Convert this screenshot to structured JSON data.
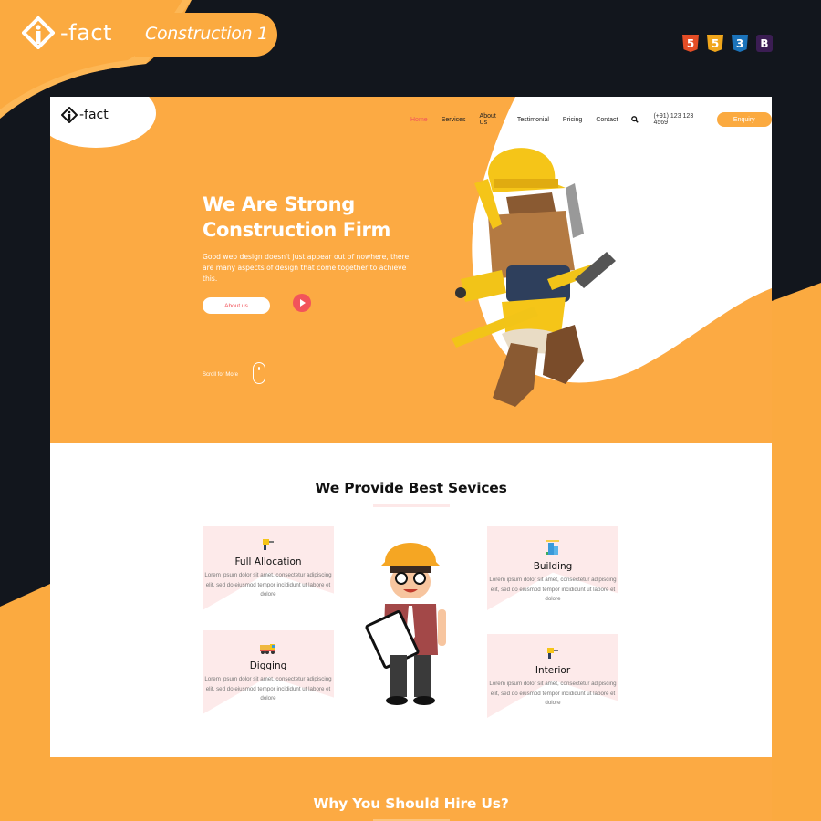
{
  "promo": {
    "brand": "-fact",
    "title": "Construction 1",
    "tech_badges": [
      {
        "name": "html5-icon",
        "glyph": "5",
        "color": "#e44d26"
      },
      {
        "name": "js-icon",
        "glyph": "5",
        "color": "#f0a61b"
      },
      {
        "name": "css3-icon",
        "glyph": "3",
        "color": "#1b73ba"
      },
      {
        "name": "bootstrap-icon",
        "glyph": "B",
        "color": "#3b1d53"
      }
    ]
  },
  "site": {
    "logo_text": "-fact",
    "nav": {
      "items": [
        "Home",
        "Services",
        "About Us",
        "Testimonial",
        "Pricing",
        "Contact"
      ],
      "active": "Home",
      "phone": "(+91) 123 123 4569",
      "enquiry_label": "Enquiry"
    },
    "hero": {
      "title_line1": "We Are Strong",
      "title_line2": "Construction Firm",
      "description": "Good web design doesn't just appear out of nowhere, there are many aspects of design that come together to achieve this.",
      "about_label": "About us",
      "scroll_label": "Scroll for More"
    },
    "services": {
      "title": "We Provide Best Sevices",
      "cards": [
        {
          "title": "Full Allocation",
          "icon": "drill-icon",
          "text": "Lorem ipsum dolor sit amet, consectetur adipiscing elit, sed do eiusmod tempor incididunt ut labore et dolore"
        },
        {
          "title": "Building",
          "icon": "building-icon",
          "text": "Lorem ipsum dolor sit amet, consectetur adipiscing elit, sed do eiusmod tempor incididunt ut labore et dolore"
        },
        {
          "title": "Digging",
          "icon": "truck-icon",
          "text": "Lorem ipsum dolor sit amet, consectetur adipiscing elit, sed do eiusmod tempor incididunt ut labore et dolore"
        },
        {
          "title": "Interior",
          "icon": "drill-icon",
          "text": "Lorem ipsum dolor sit amet, consectetur adipiscing elit, sed do eiusmod tempor incididunt ut labore et dolore"
        }
      ]
    },
    "why": {
      "title": "Why You Should Hire Us?"
    }
  },
  "colors": {
    "accent": "#fcaa43",
    "dark": "#12161d",
    "highlight": "#f2545b",
    "card_bg": "#fdeaea"
  }
}
